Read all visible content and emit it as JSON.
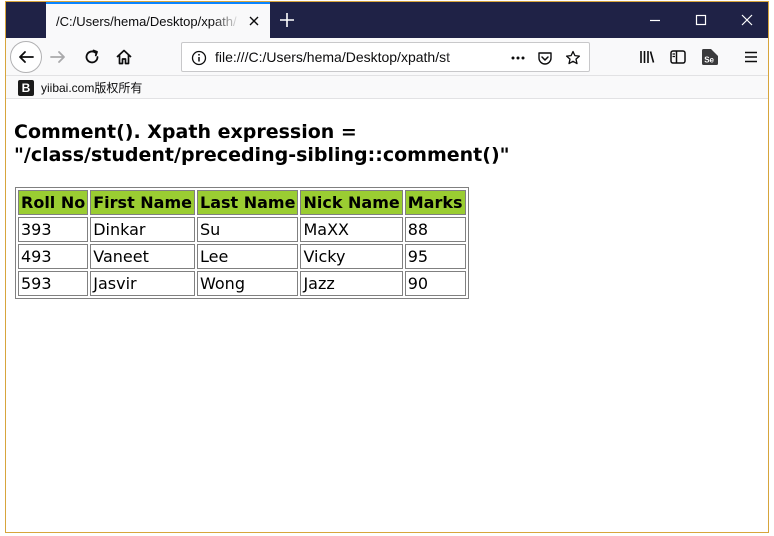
{
  "browser": {
    "tab_title": "/C:/Users/hema/Desktop/xpath/",
    "url": "file:///C:/Users/hema/Desktop/xpath/st"
  },
  "bookmarks": {
    "items": [
      {
        "icon_letter": "B",
        "label": "yiibai.com版权所有"
      }
    ]
  },
  "page": {
    "heading": "Comment(). Xpath expression = \"/class/student/preceding-sibling::comment()\"",
    "table": {
      "headers": [
        "Roll No",
        "First Name",
        "Last Name",
        "Nick Name",
        "Marks"
      ],
      "rows": [
        [
          "393",
          "Dinkar",
          "Su",
          "MaXX",
          "88"
        ],
        [
          "493",
          "Vaneet",
          "Lee",
          "Vicky",
          "95"
        ],
        [
          "593",
          "Jasvir",
          "Wong",
          "Jazz",
          "90"
        ]
      ],
      "header_color": "#9acd32"
    }
  },
  "colors": {
    "titlebar": "#1f2246",
    "tab_accent": "#0a84ff",
    "toolbar": "#f9f9fa",
    "window_border": "#d7a53c"
  }
}
